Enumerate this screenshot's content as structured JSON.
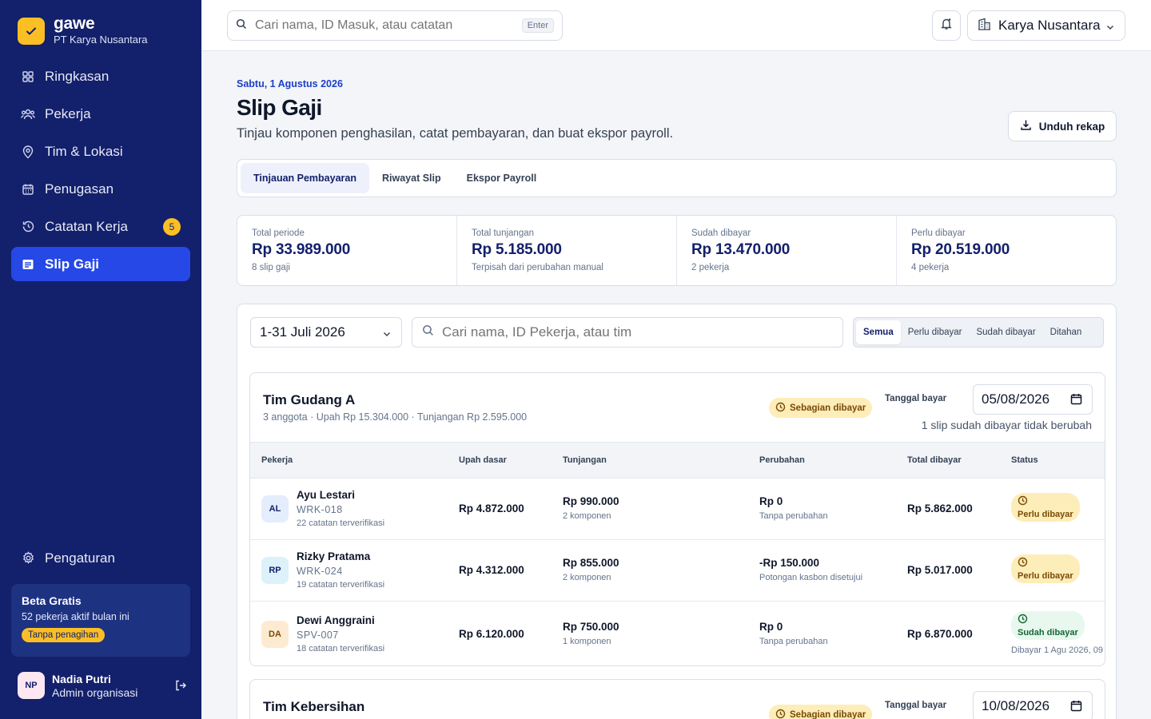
{
  "brand": {
    "name": "gawe",
    "org": "PT Karya Nusantara"
  },
  "nav": [
    {
      "label": "Ringkasan",
      "icon": "grid-icon"
    },
    {
      "label": "Pekerja",
      "icon": "users-icon"
    },
    {
      "label": "Tim & Lokasi",
      "icon": "map-pin-icon"
    },
    {
      "label": "Penugasan",
      "icon": "calendar-icon"
    },
    {
      "label": "Catatan Kerja",
      "icon": "history-icon",
      "badge": "5"
    },
    {
      "label": "Slip Gaji",
      "icon": "receipt-icon",
      "active": true
    }
  ],
  "settings_label": "Pengaturan",
  "beta": {
    "title": "Beta Gratis",
    "desc": "52 pekerja aktif bulan ini",
    "pill": "Tanpa penagihan"
  },
  "user": {
    "initials": "NP",
    "name": "Nadia Putri",
    "role": "Admin organisasi"
  },
  "topbar": {
    "search_placeholder": "Cari nama, ID Masuk, atau catatan",
    "kbd": "Enter",
    "org": "Karya Nusantara"
  },
  "page": {
    "date": "Sabtu, 1 Agustus 2026",
    "title": "Slip Gaji",
    "subtitle": "Tinjau komponen penghasilan, catat pembayaran, dan buat ekspor payroll.",
    "download": "Unduh rekap"
  },
  "tabs": [
    "Tinjauan Pembayaran",
    "Riwayat Slip",
    "Ekspor Payroll"
  ],
  "stats": [
    {
      "label": "Total periode",
      "value": "Rp 33.989.000",
      "sub": "8 slip gaji"
    },
    {
      "label": "Total tunjangan",
      "value": "Rp 5.185.000",
      "sub": "Terpisah dari perubahan manual"
    },
    {
      "label": "Sudah dibayar",
      "value": "Rp 13.470.000",
      "sub": "2 pekerja"
    },
    {
      "label": "Perlu dibayar",
      "value": "Rp 20.519.000",
      "sub": "4 pekerja"
    }
  ],
  "filters": {
    "period": "1-31 Juli 2026",
    "search_placeholder": "Cari nama, ID Pekerja, atau tim",
    "segments": [
      "Semua",
      "Perlu dibayar",
      "Sudah dibayar",
      "Ditahan"
    ]
  },
  "columns": [
    "Pekerja",
    "Upah dasar",
    "Tunjangan",
    "Perubahan",
    "Total dibayar",
    "Status"
  ],
  "teams": [
    {
      "name": "Tim Gudang A",
      "meta": "3 anggota · Upah Rp 15.304.000 · Tunjangan Rp 2.595.000",
      "status": "Sebagian dibayar",
      "pay_label": "Tanggal bayar",
      "pay_date": "05/08/2026",
      "note": "1 slip sudah dibayar tidak berubah",
      "rows": [
        {
          "initials": "AL",
          "name": "Ayu Lestari",
          "id": "WRK-018",
          "records": "22 catatan terverifikasi",
          "base": "Rp 4.872.000",
          "allow": "Rp 990.000",
          "allow_sub": "2 komponen",
          "change": "Rp 0",
          "change_sub": "Tanpa perubahan",
          "total": "Rp 5.862.000",
          "status": "Perlu dibayar"
        },
        {
          "initials": "RP",
          "name": "Rizky Pratama",
          "id": "WRK-024",
          "records": "19 catatan terverifikasi",
          "base": "Rp 4.312.000",
          "allow": "Rp 855.000",
          "allow_sub": "2 komponen",
          "change": "-Rp 150.000",
          "change_sub": "Potongan kasbon disetujui",
          "total": "Rp 5.017.000",
          "status": "Perlu dibayar"
        },
        {
          "initials": "DA",
          "name": "Dewi Anggraini",
          "id": "SPV-007",
          "records": "18 catatan terverifikasi",
          "base": "Rp 6.120.000",
          "allow": "Rp 750.000",
          "allow_sub": "1 komponen",
          "change": "Rp 0",
          "change_sub": "Tanpa perubahan",
          "total": "Rp 6.870.000",
          "status": "Sudah dibayar",
          "paid_note": "Dibayar 1 Agu 2026, 09"
        }
      ]
    },
    {
      "name": "Tim Kebersihan",
      "status": "Sebagian dibayar",
      "pay_label": "Tanggal bayar",
      "pay_date": "10/08/2026"
    }
  ]
}
